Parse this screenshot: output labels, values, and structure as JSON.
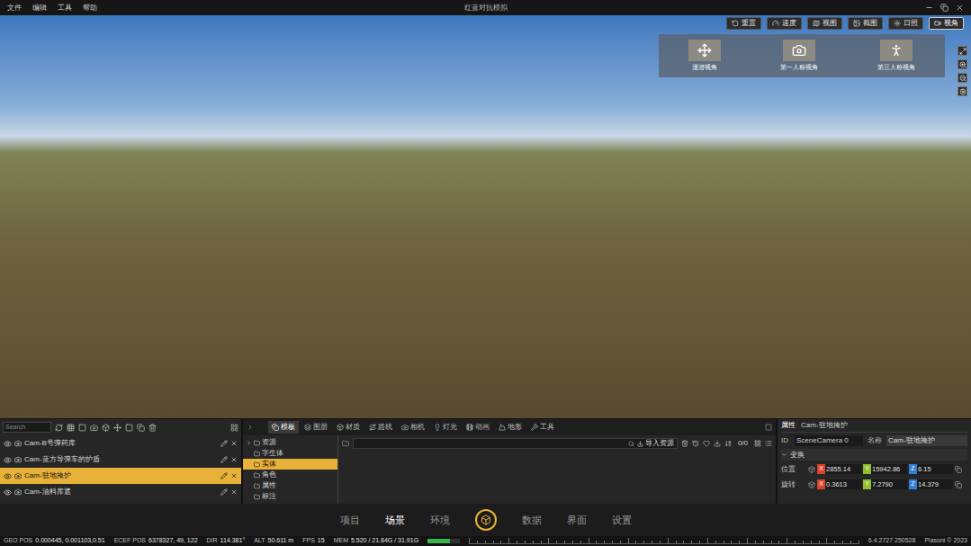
{
  "window": {
    "title": "红蓝对抗模拟",
    "menu": [
      "文件",
      "编辑",
      "工具",
      "帮助"
    ]
  },
  "viewport_toolbar": {
    "buttons": [
      {
        "label": "重置",
        "selected": false
      },
      {
        "label": "速度",
        "selected": false
      },
      {
        "label": "视图",
        "selected": false
      },
      {
        "label": "截图",
        "selected": false
      },
      {
        "label": "日照",
        "selected": false
      },
      {
        "label": "视角",
        "selected": true
      }
    ],
    "view_modes": [
      {
        "label": "漫游视角",
        "selected": false
      },
      {
        "label": "第一人称视角",
        "selected": false
      },
      {
        "label": "第三人称视角",
        "selected": false
      }
    ]
  },
  "camera_list": {
    "search_placeholder": "Search",
    "items": [
      {
        "label": "Cam-B号弹药库",
        "selected": false,
        "visible": true
      },
      {
        "label": "Cam-蓝方导弹车的护盾",
        "selected": false,
        "visible": true
      },
      {
        "label": "Cam-驻地掩护",
        "selected": true,
        "visible": true
      },
      {
        "label": "Cam-油料库遮",
        "selected": false,
        "visible": true
      }
    ]
  },
  "assets": {
    "tabs": [
      {
        "label": "模板",
        "selected": true
      },
      {
        "label": "图层",
        "selected": false
      },
      {
        "label": "材质",
        "selected": false
      },
      {
        "label": "路线",
        "selected": false
      },
      {
        "label": "相机",
        "selected": false
      },
      {
        "label": "灯光",
        "selected": false
      },
      {
        "label": "动画",
        "selected": false
      },
      {
        "label": "地形",
        "selected": false
      },
      {
        "label": "工具",
        "selected": false
      }
    ],
    "tree": [
      {
        "label": "资源",
        "selected": false,
        "expandable": true
      },
      {
        "label": "字生体",
        "selected": false,
        "expandable": false
      },
      {
        "label": "实体",
        "selected": true,
        "expandable": false
      },
      {
        "label": "角色",
        "selected": false,
        "expandable": false
      },
      {
        "label": "属性",
        "selected": false,
        "expandable": false
      },
      {
        "label": "标注",
        "selected": false,
        "expandable": false
      }
    ],
    "import_button": "导入资源",
    "count": "0/0"
  },
  "properties": {
    "title": "属性",
    "object": "Cam-驻地掩护",
    "id_label": "ID",
    "id_value": "SceneCamera 0",
    "name_label": "名称",
    "name_value": "Cam-驻地掩护",
    "section": "变换",
    "axes": [
      {
        "label": "X",
        "color": "#d9452b"
      },
      {
        "label": "Y",
        "color": "#8fbf2a"
      },
      {
        "label": "Z",
        "color": "#2f7fd6"
      }
    ],
    "rows": [
      {
        "label": "位置",
        "values": [
          "2855.14",
          "15942.86",
          "6.15"
        ]
      },
      {
        "label": "旋转",
        "values": [
          "0.3613",
          "7.2790",
          "14.379"
        ]
      }
    ]
  },
  "bottom_nav": [
    {
      "label": "项目",
      "selected": false
    },
    {
      "label": "场景",
      "selected": true
    },
    {
      "label": "环境",
      "selected": false
    },
    {
      "label": "数据",
      "selected": false
    },
    {
      "label": "界面",
      "selected": false
    },
    {
      "label": "设置",
      "selected": false
    }
  ],
  "status_bar": {
    "items": [
      {
        "label": "GEO POS",
        "value": "0.000445, 0.001103,0.51"
      },
      {
        "label": "ECEF POS",
        "value": "6378327, 49, 122"
      },
      {
        "label": "DIR",
        "value": "114.381°"
      },
      {
        "label": "ALT",
        "value": "50.611 m"
      },
      {
        "label": "FPS",
        "value": "15"
      },
      {
        "label": "MEM",
        "value": "5.520 / 21.84G / 31.91G"
      }
    ],
    "memory_level": 0.7,
    "version": "6.4.2727 250528",
    "copyright": "Plasoni © 2023"
  }
}
